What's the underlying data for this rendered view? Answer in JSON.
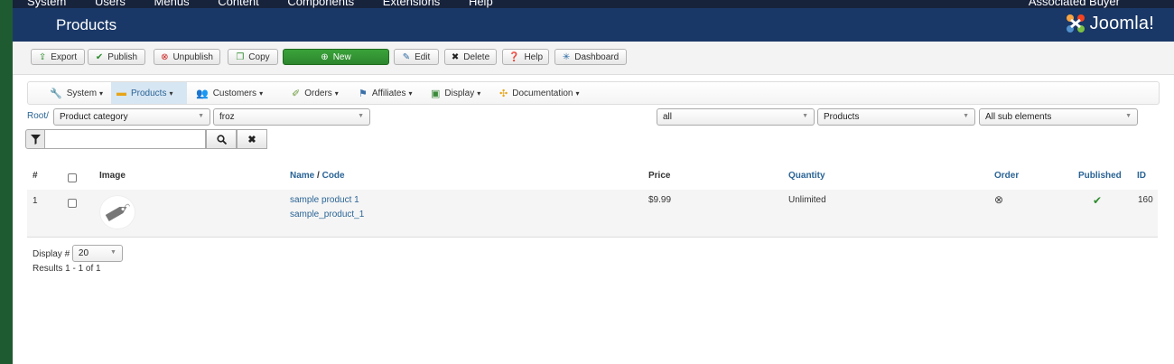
{
  "adminbar": {
    "menu": [
      "System",
      "Users",
      "Menus",
      "Content",
      "Components",
      "Extensions",
      "Help"
    ],
    "user": "Associated Buyer"
  },
  "header": {
    "title": "Products",
    "logo_text": "Joomla!"
  },
  "toolbar": {
    "buttons": [
      {
        "label": "Export",
        "icon": "export-icon"
      },
      {
        "label": "Publish",
        "icon": "check-icon"
      },
      {
        "label": "Unpublish",
        "icon": "x-circle-icon"
      },
      {
        "label": "Copy",
        "icon": "copy-icon"
      },
      {
        "label": "New",
        "icon": "plus-circle-icon"
      },
      {
        "label": "Edit",
        "icon": "edit-icon"
      },
      {
        "label": "Delete",
        "icon": "x-icon"
      },
      {
        "label": "Help",
        "icon": "question-icon"
      },
      {
        "label": "Dashboard",
        "icon": "dashboard-icon"
      }
    ]
  },
  "menu": {
    "items": [
      {
        "label": "System",
        "icon": "tools-icon"
      },
      {
        "label": "Products",
        "icon": "box-icon",
        "active": true
      },
      {
        "label": "Customers",
        "icon": "customers-icon"
      },
      {
        "label": "Orders",
        "icon": "orders-icon"
      },
      {
        "label": "Affiliates",
        "icon": "affiliates-icon"
      },
      {
        "label": "Display",
        "icon": "display-icon"
      },
      {
        "label": "Documentation",
        "icon": "documentation-icon"
      }
    ]
  },
  "filters": {
    "root_link": "Root/",
    "category_select": "Product category",
    "category_value": "froz",
    "publish_filter": "all",
    "type_filter": "Products",
    "depth_filter": "All sub elements",
    "search_value": ""
  },
  "table": {
    "headers": {
      "num": "#",
      "image": "Image",
      "name": "Name",
      "name_sep": " / ",
      "code": "Code",
      "price": "Price",
      "quantity": "Quantity",
      "order": "Order",
      "published": "Published",
      "id": "ID"
    },
    "rows": [
      {
        "num": "1",
        "name": "sample product 1",
        "code": "sample_product_1",
        "price": "$9.99",
        "quantity": "Unlimited",
        "order_icon": "x-circle-icon",
        "published_icon": "check-icon",
        "id": "160"
      }
    ]
  },
  "pagination": {
    "display_label": "Display #",
    "display_value": "20",
    "results": "Results 1 - 1 of 1"
  },
  "colors": {
    "header_bg": "#1a3867",
    "adminbar_bg": "#17223b",
    "accent_link": "#2a6496",
    "new_button": "#2d862d",
    "menu_active": "#d7e6f3"
  }
}
